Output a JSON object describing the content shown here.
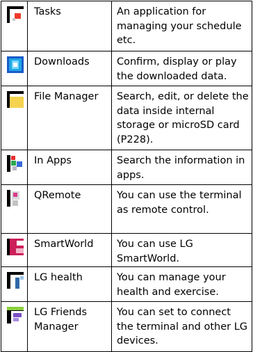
{
  "apps": [
    {
      "id": "tasks",
      "name": "Tasks",
      "description": "An application for managing your schedule etc.",
      "icon": "tasks-icon",
      "row_height": 72,
      "parts": [
        {
          "x": 0,
          "y": 0,
          "w": 24,
          "h": 24,
          "c": "#000000"
        },
        {
          "x": 4,
          "y": 4,
          "w": 20,
          "h": 20,
          "c": "#ffffff"
        },
        {
          "x": 11,
          "y": 10,
          "w": 9,
          "h": 8,
          "c": "#ee3a2a"
        },
        {
          "x": 8,
          "y": 17,
          "w": 4,
          "h": 4,
          "c": "#c9c9c9"
        }
      ]
    },
    {
      "id": "downloads",
      "name": "Downloads",
      "description": "Confirm, display or play the downloaded data.",
      "icon": "downloads-icon",
      "row_height": 50,
      "parts": [
        {
          "x": 0,
          "y": 0,
          "w": 24,
          "h": 24,
          "c": "#1a5cc8"
        },
        {
          "x": 3,
          "y": 3,
          "w": 18,
          "h": 18,
          "c": "#20a6e6"
        },
        {
          "x": 7,
          "y": 6,
          "w": 10,
          "h": 12,
          "c": "#7ad8ff"
        },
        {
          "x": 9,
          "y": 9,
          "w": 6,
          "h": 6,
          "c": "#ffffff"
        }
      ]
    },
    {
      "id": "file-manager",
      "name": "File Manager",
      "description": "Search, edit, or delete the data inside internal storage or microSD card (P228).",
      "icon": "folder-icon",
      "row_height": 92,
      "parts": [
        {
          "x": 0,
          "y": 0,
          "w": 24,
          "h": 24,
          "c": "#000000"
        },
        {
          "x": 4,
          "y": 4,
          "w": 20,
          "h": 20,
          "c": "#ffffff"
        },
        {
          "x": 4,
          "y": 8,
          "w": 20,
          "h": 16,
          "c": "#f5d34f"
        }
      ]
    },
    {
      "id": "in-apps",
      "name": "In Apps",
      "description": "Search the information in apps.",
      "icon": "in-apps-icon",
      "row_height": 50,
      "parts": [
        {
          "x": 0,
          "y": 0,
          "w": 24,
          "h": 24,
          "c": "#000000"
        },
        {
          "x": 5,
          "y": 0,
          "w": 19,
          "h": 24,
          "c": "#ffffff"
        },
        {
          "x": 6,
          "y": 1,
          "w": 6,
          "h": 6,
          "c": "#e62f2f"
        },
        {
          "x": 6,
          "y": 8,
          "w": 7,
          "h": 7,
          "c": "#2aa84a"
        },
        {
          "x": 14,
          "y": 9,
          "w": 8,
          "h": 8,
          "c": "#3a6ad8"
        },
        {
          "x": 8,
          "y": 16,
          "w": 6,
          "h": 6,
          "c": "#b8b8c8"
        }
      ]
    },
    {
      "id": "qremote",
      "name": "QRemote",
      "description": "You can use the terminal as remote control.",
      "icon": "remote-icon",
      "row_height": 70,
      "parts": [
        {
          "x": 0,
          "y": 0,
          "w": 24,
          "h": 24,
          "c": "#000000"
        },
        {
          "x": 5,
          "y": 0,
          "w": 19,
          "h": 24,
          "c": "#ffffff"
        },
        {
          "x": 7,
          "y": 2,
          "w": 11,
          "h": 12,
          "c": "#d9d9d9"
        },
        {
          "x": 9,
          "y": 4,
          "w": 6,
          "h": 6,
          "c": "#d93a8a"
        },
        {
          "x": 8,
          "y": 15,
          "w": 8,
          "h": 8,
          "c": "#c4c4c4"
        }
      ]
    },
    {
      "id": "smartworld",
      "name": "SmartWorld",
      "description": "You can use LG SmartWorld.",
      "icon": "smartworld-icon",
      "row_height": 48,
      "parts": [
        {
          "x": 0,
          "y": 0,
          "w": 24,
          "h": 24,
          "c": "#000000"
        },
        {
          "x": 4,
          "y": 0,
          "w": 20,
          "h": 24,
          "c": "#cc1f5a"
        },
        {
          "x": 14,
          "y": 3,
          "w": 10,
          "h": 7,
          "c": "#ffffff"
        },
        {
          "x": 13,
          "y": 14,
          "w": 11,
          "h": 7,
          "c": "#f2b3c9"
        }
      ]
    },
    {
      "id": "lg-health",
      "name": "LG health",
      "description": "You can manage your health and exercise.",
      "icon": "health-icon",
      "row_height": 50,
      "parts": [
        {
          "x": 0,
          "y": 0,
          "w": 24,
          "h": 24,
          "c": "#000000"
        },
        {
          "x": 5,
          "y": 4,
          "w": 19,
          "h": 20,
          "c": "#ffffff"
        },
        {
          "x": 12,
          "y": 8,
          "w": 6,
          "h": 16,
          "c": "#2f6aa6"
        },
        {
          "x": 19,
          "y": 6,
          "w": 5,
          "h": 5,
          "c": "#9cc5e8"
        }
      ]
    },
    {
      "id": "lg-friends-manager",
      "name": "LG Friends Manager",
      "description": "You can set to connect the terminal and other LG devices.",
      "icon": "friends-manager-icon",
      "row_height": 72,
      "parts": [
        {
          "x": 0,
          "y": 0,
          "w": 24,
          "h": 24,
          "c": "#000000"
        },
        {
          "x": 0,
          "y": 0,
          "w": 24,
          "h": 5,
          "c": "#8bd13f"
        },
        {
          "x": 6,
          "y": 6,
          "w": 18,
          "h": 18,
          "c": "#ffffff"
        },
        {
          "x": 9,
          "y": 9,
          "w": 12,
          "h": 6,
          "c": "#7b4fc2"
        },
        {
          "x": 9,
          "y": 16,
          "w": 8,
          "h": 5,
          "c": "#a98be0"
        }
      ]
    }
  ]
}
